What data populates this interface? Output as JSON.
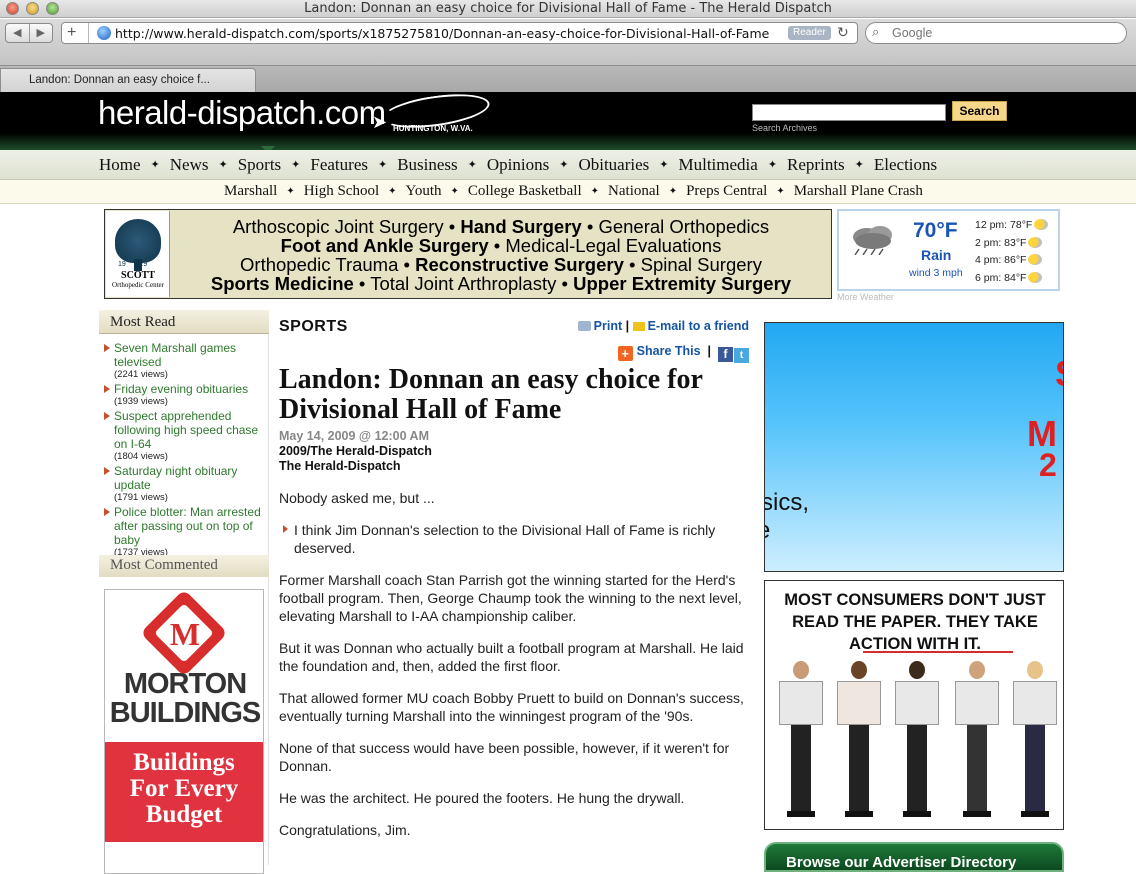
{
  "browser": {
    "window_title": "Landon: Donnan an easy choice for Divisional Hall of Fame - The Herald Dispatch",
    "url": "http://www.herald-dispatch.com/sports/x1875275810/Donnan-an-easy-choice-for-Divisional-Hall-of-Fame",
    "reader_label": "Reader",
    "search_placeholder": "Google",
    "tab_title": "Landon: Donnan an easy choice f..."
  },
  "site": {
    "logo_text": "herald-dispatch.com",
    "logo_sub": "HUNTINGTON, W.VA.",
    "search_button": "Search",
    "search_archives": "Search Archives"
  },
  "nav": {
    "main": [
      "Home",
      "News",
      "Sports",
      "Features",
      "Business",
      "Opinions",
      "Obituaries",
      "Multimedia",
      "Reprints",
      "Elections"
    ],
    "sub": [
      "Marshall",
      "High School",
      "Youth",
      "College Basketball",
      "National",
      "Preps Central",
      "Marshall Plane Crash"
    ],
    "separator": "✦"
  },
  "banner_ad": {
    "logo_year_left": "19",
    "logo_year_right": "29",
    "logo_name": "SCOTT",
    "logo_sub": "Orthopedic Center",
    "line1a": "Arthoscopic Joint Surgery • ",
    "line1b": "Hand Surgery",
    "line1c": " • General Orthopedics",
    "line2a": "Foot and Ankle Surgery",
    "line2b": " • Medical-Legal Evaluations",
    "line3a": "Orthopedic Trauma • ",
    "line3b": "Reconstructive Surgery",
    "line3c": " • Spinal Surgery",
    "line4a": "Sports Medicine",
    "line4b": " • Total Joint Arthroplasty • ",
    "line4c": "Upper Extremity Surgery"
  },
  "weather": {
    "temp": "70°F",
    "condition": "Rain",
    "wind": "wind 3 mph",
    "forecast": [
      "12 pm: 78°F",
      "2 pm: 83°F",
      "4 pm: 86°F",
      "6 pm: 84°F"
    ],
    "more": "More Weather"
  },
  "most_read": {
    "title": "Most Read",
    "items": [
      {
        "title": "Seven Marshall games televised",
        "views": "(2241 views)"
      },
      {
        "title": "Friday evening obituaries",
        "views": "(1939 views)"
      },
      {
        "title": "Suspect apprehended following high speed chase on I-64",
        "views": "(1804 views)"
      },
      {
        "title": "Saturday night obituary update",
        "views": "(1791 views)"
      },
      {
        "title": "Police blotter: Man arrested after passing out on top of baby",
        "views": "(1737 views)"
      }
    ]
  },
  "most_commented": {
    "title": "Most Commented"
  },
  "morton_ad": {
    "name_line1": "MORTON",
    "name_line2": "BUILDINGS",
    "tag1": "Buildings",
    "tag2": "For Every",
    "tag3": "Budget"
  },
  "article": {
    "section": "SPORTS",
    "print_label": "Print",
    "email_label": "E-mail to a friend",
    "share_label": "Share This",
    "headline": "Landon: Donnan an easy choice for Divisional Hall of Fame",
    "date": "May 14, 2009 @ 12:00 AM",
    "byline1": "2009/The Herald-Dispatch",
    "byline2": "The Herald-Dispatch",
    "paragraphs": [
      "Nobody asked me, but ...",
      "I think Jim Donnan's selection to the Divisional Hall of Fame is richly deserved.",
      "Former Marshall coach Stan Parrish got the winning started for the Herd's football program. Then, George Chaump took the winning to the next level, elevating Marshall to I-AA championship caliber.",
      "But it was Donnan who actually built a football program at Marshall. He laid the foundation and, then, added the first floor.",
      "That allowed former MU coach Bobby Pruett to build on Donnan's success, eventually turning Marshall into the winningest program of the '90s.",
      "None of that success would have been possible, however, if it weren't for Donnan.",
      "He was the architect. He poured the footers. He hung the drywall.",
      "Congratulations, Jim."
    ]
  },
  "right_ads": {
    "ad1_fragment1": "sics,",
    "ad1_fragment2": "e",
    "ad1_red1": "S",
    "ad1_red2": "M",
    "ad1_red3": "2",
    "ad2_text": "MOST CONSUMERS DON'T JUST READ THE PAPER. THEY TAKE ACTION WITH IT.",
    "ad3_text": "Browse our Advertiser Directory"
  }
}
